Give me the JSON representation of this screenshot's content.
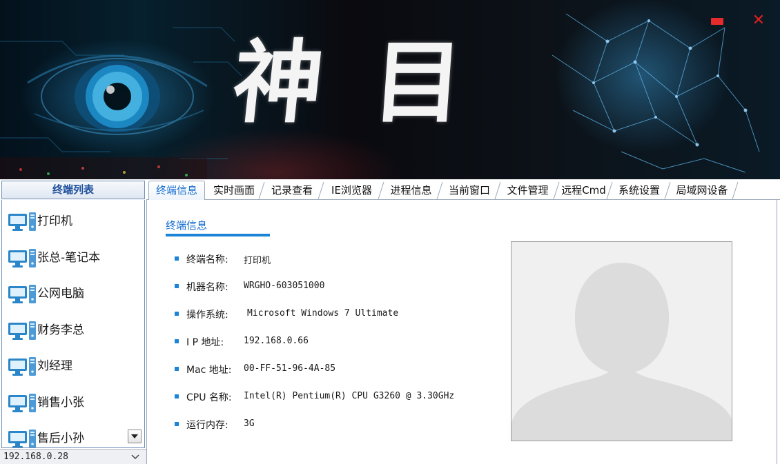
{
  "banner": {
    "title_char_1": "神",
    "title_char_2": "目",
    "minimize_icon": "minimize-icon",
    "close_icon": "close-icon",
    "close_glyph": "✕"
  },
  "sidebar": {
    "header": "终端列表",
    "items": [
      {
        "label": "打印机",
        "icon": "computer-icon"
      },
      {
        "label": "张总-笔记本",
        "icon": "computer-icon"
      },
      {
        "label": "公网电脑",
        "icon": "computer-icon"
      },
      {
        "label": "财务李总",
        "icon": "computer-icon"
      },
      {
        "label": "刘经理",
        "icon": "computer-icon"
      },
      {
        "label": "销售小张",
        "icon": "computer-icon"
      },
      {
        "label": "售后小孙",
        "icon": "computer-icon"
      }
    ],
    "ip_select": {
      "value": "192.168.0.28"
    }
  },
  "tabs": [
    {
      "label": "终端信息",
      "active": true
    },
    {
      "label": "实时画面"
    },
    {
      "label": "记录查看"
    },
    {
      "label": "IE浏览器"
    },
    {
      "label": "进程信息"
    },
    {
      "label": "当前窗口"
    },
    {
      "label": "文件管理"
    },
    {
      "label": "远程Cmd"
    },
    {
      "label": "系统设置"
    },
    {
      "label": "局域网设备"
    }
  ],
  "terminal_info": {
    "section_title": "终端信息",
    "rows": [
      {
        "key": "终端名称:",
        "value": "打印机"
      },
      {
        "key": "机器名称:",
        "value": "WRGHO-603051000"
      },
      {
        "key": "操作系统:",
        "value": " Microsoft Windows 7 Ultimate"
      },
      {
        "key": "I P 地址:",
        "value": "192.168.0.66"
      },
      {
        "key": "Mac 地址:",
        "value": "00-FF-51-96-4A-85"
      },
      {
        "key": "CPU 名称:",
        "value": "Intel(R) Pentium(R) CPU G3260 @ 3.30GHz"
      },
      {
        "key": "运行内存:",
        "value": "3G"
      }
    ],
    "avatar_icon": "user-silhouette-icon"
  },
  "colors": {
    "accent": "#1b84d6",
    "tab_active_text": "#1a6fcf",
    "close_red": "#e02020"
  }
}
